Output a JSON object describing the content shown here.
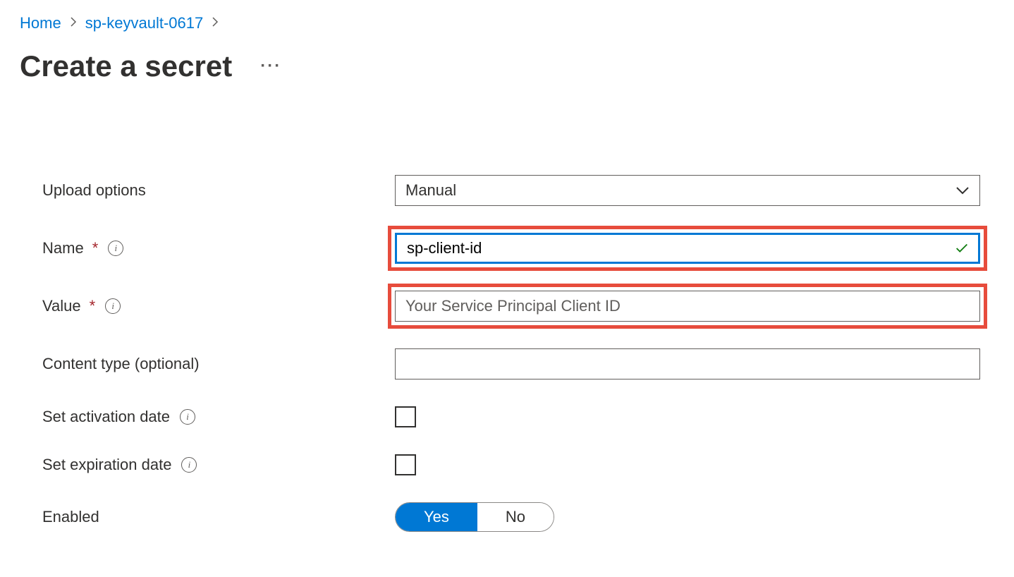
{
  "breadcrumb": {
    "home": "Home",
    "keyvault": "sp-keyvault-0617"
  },
  "page_title": "Create a secret",
  "form": {
    "upload_options": {
      "label": "Upload options",
      "value": "Manual"
    },
    "name": {
      "label": "Name",
      "value": "sp-client-id"
    },
    "value": {
      "label": "Value",
      "placeholder": "Your Service Principal Client ID",
      "value": ""
    },
    "content_type": {
      "label": "Content type (optional)",
      "value": ""
    },
    "activation_date": {
      "label": "Set activation date"
    },
    "expiration_date": {
      "label": "Set expiration date"
    },
    "enabled": {
      "label": "Enabled",
      "yes": "Yes",
      "no": "No"
    }
  }
}
